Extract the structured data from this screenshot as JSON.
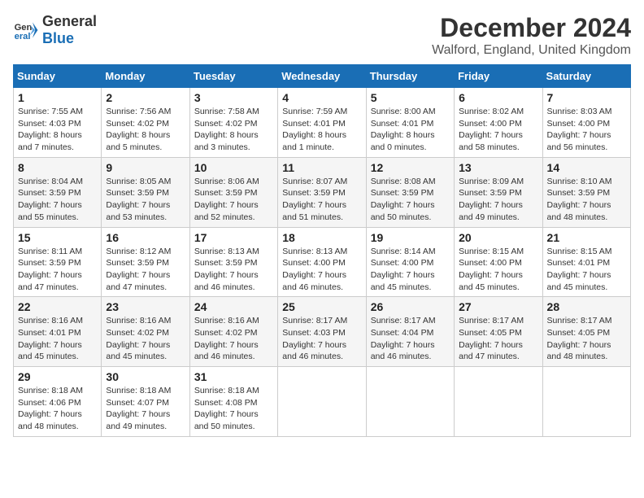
{
  "logo": {
    "line1": "General",
    "line2": "Blue"
  },
  "title": "December 2024",
  "subtitle": "Walford, England, United Kingdom",
  "header_days": [
    "Sunday",
    "Monday",
    "Tuesday",
    "Wednesday",
    "Thursday",
    "Friday",
    "Saturday"
  ],
  "weeks": [
    [
      {
        "day": "1",
        "detail": "Sunrise: 7:55 AM\nSunset: 4:03 PM\nDaylight: 8 hours\nand 7 minutes."
      },
      {
        "day": "2",
        "detail": "Sunrise: 7:56 AM\nSunset: 4:02 PM\nDaylight: 8 hours\nand 5 minutes."
      },
      {
        "day": "3",
        "detail": "Sunrise: 7:58 AM\nSunset: 4:02 PM\nDaylight: 8 hours\nand 3 minutes."
      },
      {
        "day": "4",
        "detail": "Sunrise: 7:59 AM\nSunset: 4:01 PM\nDaylight: 8 hours\nand 1 minute."
      },
      {
        "day": "5",
        "detail": "Sunrise: 8:00 AM\nSunset: 4:01 PM\nDaylight: 8 hours\nand 0 minutes."
      },
      {
        "day": "6",
        "detail": "Sunrise: 8:02 AM\nSunset: 4:00 PM\nDaylight: 7 hours\nand 58 minutes."
      },
      {
        "day": "7",
        "detail": "Sunrise: 8:03 AM\nSunset: 4:00 PM\nDaylight: 7 hours\nand 56 minutes."
      }
    ],
    [
      {
        "day": "8",
        "detail": "Sunrise: 8:04 AM\nSunset: 3:59 PM\nDaylight: 7 hours\nand 55 minutes."
      },
      {
        "day": "9",
        "detail": "Sunrise: 8:05 AM\nSunset: 3:59 PM\nDaylight: 7 hours\nand 53 minutes."
      },
      {
        "day": "10",
        "detail": "Sunrise: 8:06 AM\nSunset: 3:59 PM\nDaylight: 7 hours\nand 52 minutes."
      },
      {
        "day": "11",
        "detail": "Sunrise: 8:07 AM\nSunset: 3:59 PM\nDaylight: 7 hours\nand 51 minutes."
      },
      {
        "day": "12",
        "detail": "Sunrise: 8:08 AM\nSunset: 3:59 PM\nDaylight: 7 hours\nand 50 minutes."
      },
      {
        "day": "13",
        "detail": "Sunrise: 8:09 AM\nSunset: 3:59 PM\nDaylight: 7 hours\nand 49 minutes."
      },
      {
        "day": "14",
        "detail": "Sunrise: 8:10 AM\nSunset: 3:59 PM\nDaylight: 7 hours\nand 48 minutes."
      }
    ],
    [
      {
        "day": "15",
        "detail": "Sunrise: 8:11 AM\nSunset: 3:59 PM\nDaylight: 7 hours\nand 47 minutes."
      },
      {
        "day": "16",
        "detail": "Sunrise: 8:12 AM\nSunset: 3:59 PM\nDaylight: 7 hours\nand 47 minutes."
      },
      {
        "day": "17",
        "detail": "Sunrise: 8:13 AM\nSunset: 3:59 PM\nDaylight: 7 hours\nand 46 minutes."
      },
      {
        "day": "18",
        "detail": "Sunrise: 8:13 AM\nSunset: 4:00 PM\nDaylight: 7 hours\nand 46 minutes."
      },
      {
        "day": "19",
        "detail": "Sunrise: 8:14 AM\nSunset: 4:00 PM\nDaylight: 7 hours\nand 45 minutes."
      },
      {
        "day": "20",
        "detail": "Sunrise: 8:15 AM\nSunset: 4:00 PM\nDaylight: 7 hours\nand 45 minutes."
      },
      {
        "day": "21",
        "detail": "Sunrise: 8:15 AM\nSunset: 4:01 PM\nDaylight: 7 hours\nand 45 minutes."
      }
    ],
    [
      {
        "day": "22",
        "detail": "Sunrise: 8:16 AM\nSunset: 4:01 PM\nDaylight: 7 hours\nand 45 minutes."
      },
      {
        "day": "23",
        "detail": "Sunrise: 8:16 AM\nSunset: 4:02 PM\nDaylight: 7 hours\nand 45 minutes."
      },
      {
        "day": "24",
        "detail": "Sunrise: 8:16 AM\nSunset: 4:02 PM\nDaylight: 7 hours\nand 46 minutes."
      },
      {
        "day": "25",
        "detail": "Sunrise: 8:17 AM\nSunset: 4:03 PM\nDaylight: 7 hours\nand 46 minutes."
      },
      {
        "day": "26",
        "detail": "Sunrise: 8:17 AM\nSunset: 4:04 PM\nDaylight: 7 hours\nand 46 minutes."
      },
      {
        "day": "27",
        "detail": "Sunrise: 8:17 AM\nSunset: 4:05 PM\nDaylight: 7 hours\nand 47 minutes."
      },
      {
        "day": "28",
        "detail": "Sunrise: 8:17 AM\nSunset: 4:05 PM\nDaylight: 7 hours\nand 48 minutes."
      }
    ],
    [
      {
        "day": "29",
        "detail": "Sunrise: 8:18 AM\nSunset: 4:06 PM\nDaylight: 7 hours\nand 48 minutes."
      },
      {
        "day": "30",
        "detail": "Sunrise: 8:18 AM\nSunset: 4:07 PM\nDaylight: 7 hours\nand 49 minutes."
      },
      {
        "day": "31",
        "detail": "Sunrise: 8:18 AM\nSunset: 4:08 PM\nDaylight: 7 hours\nand 50 minutes."
      },
      {
        "day": "",
        "detail": ""
      },
      {
        "day": "",
        "detail": ""
      },
      {
        "day": "",
        "detail": ""
      },
      {
        "day": "",
        "detail": ""
      }
    ]
  ]
}
